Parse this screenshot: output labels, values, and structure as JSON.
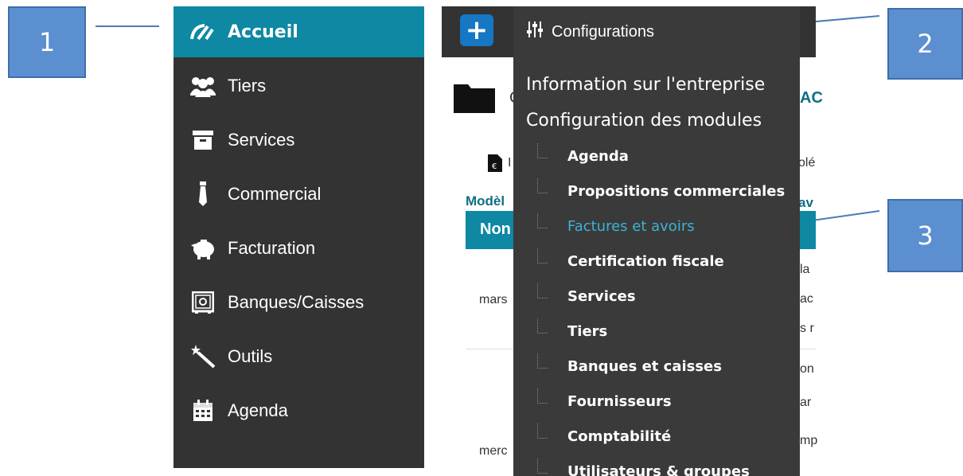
{
  "callouts": {
    "one": "1",
    "two": "2",
    "three": "3"
  },
  "sidebar": {
    "items": [
      {
        "label": "Accueil",
        "icon": "dashboard-gauge-icon",
        "active": true
      },
      {
        "label": "Tiers",
        "icon": "users-group-icon"
      },
      {
        "label": "Services",
        "icon": "archive-box-icon"
      },
      {
        "label": "Commercial",
        "icon": "necktie-icon"
      },
      {
        "label": "Facturation",
        "icon": "piggy-bank-icon"
      },
      {
        "label": "Banques/Caisses",
        "icon": "safe-icon"
      },
      {
        "label": "Outils",
        "icon": "magic-wand-icon"
      },
      {
        "label": "Agenda",
        "icon": "calendar-icon"
      }
    ]
  },
  "topbar": {
    "add_label": "+"
  },
  "dropdown": {
    "title": "Configurations",
    "title_icon": "sliders-icon",
    "company_info": "Information sur l'entreprise",
    "modules_config": "Configuration des modules",
    "items": [
      "Agenda",
      "Propositions commerciales",
      "Factures et avoirs",
      "Certification fiscale",
      "Services",
      "Tiers",
      "Banques et caisses",
      "Fournisseurs",
      "Comptabilité",
      "Utilisateurs & groupes"
    ],
    "highlighted_index": 2
  },
  "background_page": {
    "folder_icon": "folder-icon",
    "heading_fragment": "C",
    "heading_fragment_right": "AC",
    "doc_icon": "invoice-document-icon",
    "tab_fragment": "I",
    "tab_fragment_right": "olé",
    "models_label": "Modèl",
    "models_right": "av",
    "table_header": "Non",
    "row1_cell": "mars",
    "row2_cell": "merc",
    "right_fragments": [
      "la",
      "ac",
      "s r",
      "on",
      "ar",
      "mp"
    ]
  },
  "colors": {
    "accent": "#0e88a3",
    "sidebar_bg": "#333333",
    "dropdown_bg": "#3a3a3a",
    "highlight": "#3db2d6",
    "callout": "#5b8fd0"
  }
}
